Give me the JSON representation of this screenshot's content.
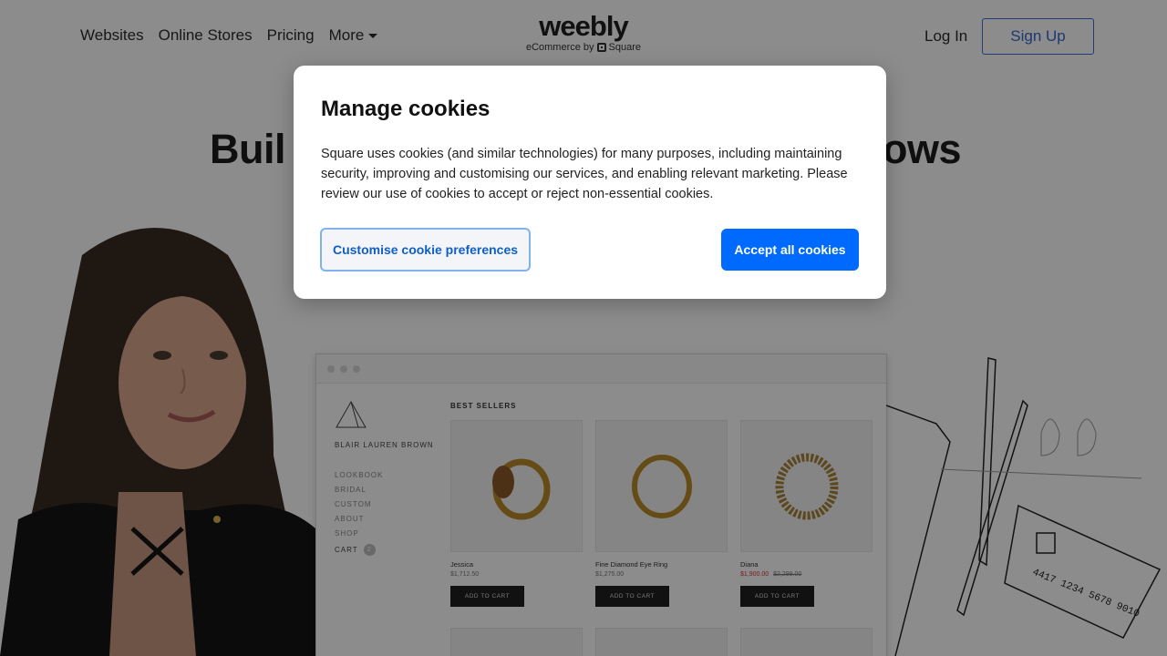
{
  "nav": {
    "items": [
      "Websites",
      "Online Stores",
      "Pricing"
    ],
    "more_label": "More",
    "logo_word": "weebly",
    "logo_sub_prefix": "eCommerce by",
    "logo_sub_brand": "Square",
    "login_label": "Log In",
    "signup_label": "Sign Up"
  },
  "hero": {
    "title_left": "Buil",
    "title_right": "ows"
  },
  "store": {
    "brand": "BLAIR LAUREN BROWN",
    "links": [
      "LOOKBOOK",
      "BRIDAL",
      "CUSTOM",
      "ABOUT",
      "SHOP"
    ],
    "cart_label": "CART",
    "cart_count": "2",
    "section_title": "BEST SELLERS",
    "products": [
      {
        "name": "Jessica",
        "price": "$1,712.50",
        "old_price": "",
        "button": "ADD TO CART"
      },
      {
        "name": "Fine Diamond Eye Ring",
        "price": "$1,275.00",
        "old_price": "",
        "button": "ADD TO CART"
      },
      {
        "name": "Diana",
        "price": "$1,900.00",
        "old_price": "$2,299.00",
        "button": "ADD TO CART"
      }
    ]
  },
  "sketch": {
    "card_number": "4417 1234 5678 9010"
  },
  "dialog": {
    "title": "Manage cookies",
    "body": "Square uses cookies (and similar technologies) for many purposes, including maintaining security, improving and customising our services, and enabling relevant marketing. Please review our use of cookies to accept or reject non-essential cookies.",
    "customise_label": "Customise cookie preferences",
    "accept_label": "Accept all cookies"
  },
  "colors": {
    "accent": "#006aff",
    "signup_border": "#3d6bd6",
    "overlay": "rgba(0,0,0,0.45)"
  }
}
